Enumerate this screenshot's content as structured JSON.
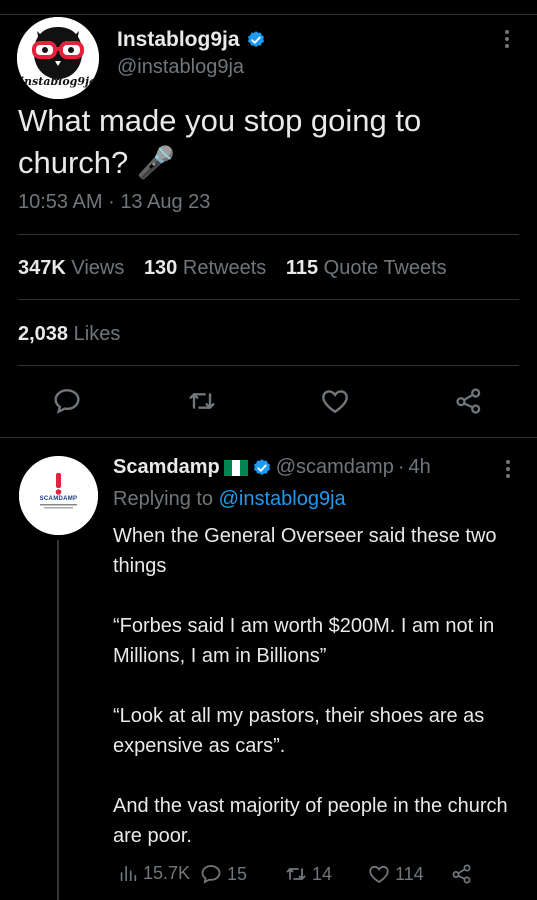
{
  "tweet": {
    "author_name": "Instablog9ja",
    "author_handle": "@instablog9ja",
    "avatar_caption": "instablog9ja",
    "text": "What made you stop going to church? 🎤",
    "time": "10:53 AM",
    "date_sep": "·",
    "date": "13 Aug 23",
    "views_count": "347K",
    "views_label": "Views",
    "retweets_count": "130",
    "retweets_label": "Retweets",
    "quotes_count": "115",
    "quotes_label": "Quote Tweets",
    "likes_count": "2,038",
    "likes_label": "Likes"
  },
  "reply": {
    "author_name": "Scamdamp",
    "author_handle": "@scamdamp",
    "time_sep": "·",
    "time": "4h",
    "avatar_text": "SCAMDAMP",
    "replying_prefix": "Replying to",
    "replying_handle": "@instablog9ja",
    "paragraphs": [
      "When the General Overseer said these two things",
      "“Forbes said I am worth $200M. I am not in Millions, I am in Billions”",
      "“Look at all my pastors, their shoes are as expensive as cars”.",
      "And the vast majority of people in the church are poor."
    ],
    "views": "15.7K",
    "replies": "15",
    "retweets": "14",
    "likes": "114"
  },
  "colors": {
    "background": "#000000",
    "text": "#e7e9ea",
    "secondary": "#71767b",
    "accent": "#1d9bf0",
    "divider": "#2f3336"
  }
}
